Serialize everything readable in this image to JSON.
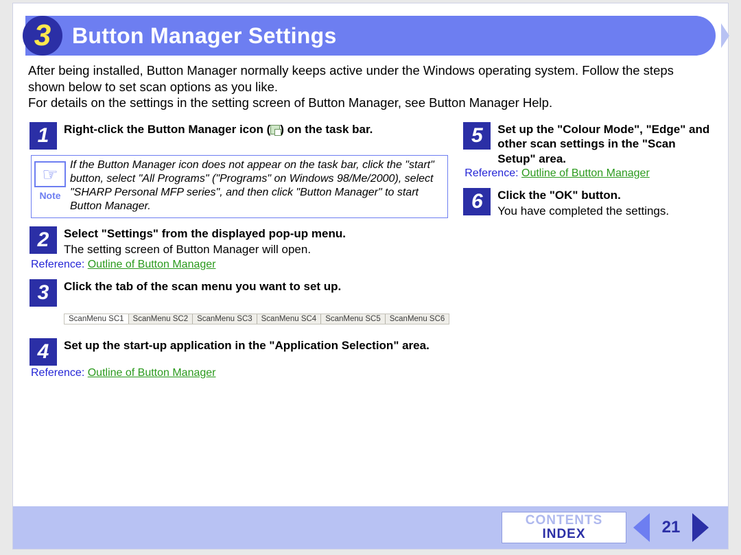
{
  "header": {
    "chapter_number": "3",
    "title": "Button Manager Settings"
  },
  "intro": {
    "p1": "After being installed, Button Manager normally keeps active under the Windows operating system. Follow the steps shown below to set scan options as you like.",
    "p2": "For details on the settings in the setting screen of Button Manager, see Button Manager Help."
  },
  "note": {
    "label": "Note",
    "text": "If the Button Manager icon does not appear on the task bar, click the \"start\" button, select \"All Programs\" (\"Programs\" on Windows 98/Me/2000), select \"SHARP Personal MFP series\", and then click \"Button Manager\" to start Button Manager."
  },
  "steps": {
    "s1": {
      "num": "1",
      "heading_a": "Right-click the Button Manager icon (",
      "heading_b": ") on the task bar."
    },
    "s2": {
      "num": "2",
      "heading": "Select \"Settings\" from the displayed pop-up menu.",
      "desc": "The setting screen of Button Manager will open."
    },
    "s3": {
      "num": "3",
      "heading": "Click the tab of the scan menu you want to set up."
    },
    "s4": {
      "num": "4",
      "heading": "Set up the start-up application in the \"Application Selection\" area."
    },
    "s5": {
      "num": "5",
      "heading": "Set up the \"Colour Mode\", \"Edge\" and other scan settings in the \"Scan Setup\" area."
    },
    "s6": {
      "num": "6",
      "heading": "Click the \"OK\" button.",
      "desc": "You have completed the settings."
    }
  },
  "reference": {
    "label": "Reference:",
    "link_text": "Outline of Button Manager"
  },
  "tabs": [
    "ScanMenu SC1",
    "ScanMenu SC2",
    "ScanMenu SC3",
    "ScanMenu SC4",
    "ScanMenu SC5",
    "ScanMenu SC6"
  ],
  "footer": {
    "contents": "CONTENTS",
    "index": "INDEX",
    "page": "21"
  }
}
